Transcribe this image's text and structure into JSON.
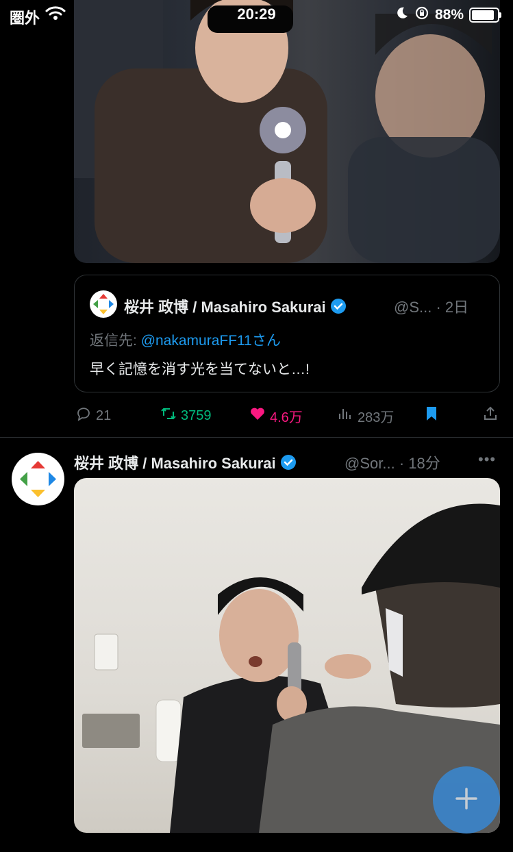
{
  "status_bar": {
    "carrier": "圏外",
    "time": "20:29",
    "battery": "88%",
    "battery_level": 0.88
  },
  "quoted_tweet": {
    "author": "桜井 政博 / Masahiro Sakurai",
    "handle": "@S...",
    "time": "· 2日",
    "reply_prefix": "返信先:",
    "reply_mention": "@nakamuraFF11",
    "reply_suffix": "さん",
    "text": "早く記憶を消す光を当てないと…!"
  },
  "actions": {
    "replies": "21",
    "retweets": "3759",
    "likes": "4.6万",
    "views": "283万"
  },
  "tweet": {
    "author": "桜井 政博 / Masahiro Sakurai",
    "handle": "@Sor...",
    "time": "· 18分",
    "more": "•••"
  },
  "colors": {
    "accent": "#1d9bf0",
    "retweet": "#00ba7c",
    "like": "#f91880",
    "muted": "#71767b",
    "fab": "#3b84c9"
  },
  "icons": [
    "wifi-icon",
    "moon-icon",
    "orientation-lock-icon",
    "battery-icon",
    "verified-icon",
    "reply-icon",
    "retweet-icon",
    "heart-icon",
    "views-icon",
    "bookmark-icon",
    "share-icon",
    "more-icon",
    "plus-icon"
  ]
}
